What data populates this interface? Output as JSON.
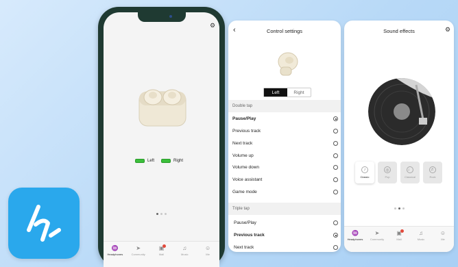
{
  "colors": {
    "brand_blue": "#2aa8ec",
    "battery_green": "#3bbf3b",
    "phone_frame": "#1f3a32",
    "badge_red": "#e24a3c"
  },
  "app_icon": {
    "name": "edifier-app-icon"
  },
  "phone": {
    "battery": {
      "left_label": "Left",
      "right_label": "Right"
    },
    "tabs": [
      {
        "label": "Headphones",
        "icon": "headphones-icon"
      },
      {
        "label": "Community",
        "icon": "paper-plane-icon"
      },
      {
        "label": "Mall",
        "icon": "shop-icon"
      },
      {
        "label": "Music",
        "icon": "music-note-icon"
      },
      {
        "label": "Me",
        "icon": "person-icon"
      }
    ]
  },
  "control": {
    "title": "Control settings",
    "side_toggle": {
      "left": "Left",
      "right": "Right",
      "selected": "Left"
    },
    "double_tap": {
      "heading": "Double tap",
      "options": [
        {
          "label": "Pause/Play",
          "selected": true
        },
        {
          "label": "Previous track",
          "selected": false
        },
        {
          "label": "Next track",
          "selected": false
        },
        {
          "label": "Volume up",
          "selected": false
        },
        {
          "label": "Volume down",
          "selected": false
        },
        {
          "label": "Voice assistant",
          "selected": false
        },
        {
          "label": "Game mode",
          "selected": false
        }
      ]
    },
    "triple_tap": {
      "heading": "Triple tap",
      "options": [
        {
          "label": "Pause/Play",
          "selected": false
        },
        {
          "label": "Previous track",
          "selected": true
        },
        {
          "label": "Next track",
          "selected": false
        }
      ]
    }
  },
  "sound": {
    "title": "Sound effects",
    "effects": [
      {
        "label": "Classic",
        "selected": true
      },
      {
        "label": "Pop",
        "selected": false
      },
      {
        "label": "Classical",
        "selected": false
      },
      {
        "label": "Rock",
        "selected": false
      }
    ],
    "tabs": [
      {
        "label": "Headphones"
      },
      {
        "label": "Community"
      },
      {
        "label": "Mall"
      },
      {
        "label": "Music"
      },
      {
        "label": "Me"
      }
    ]
  }
}
